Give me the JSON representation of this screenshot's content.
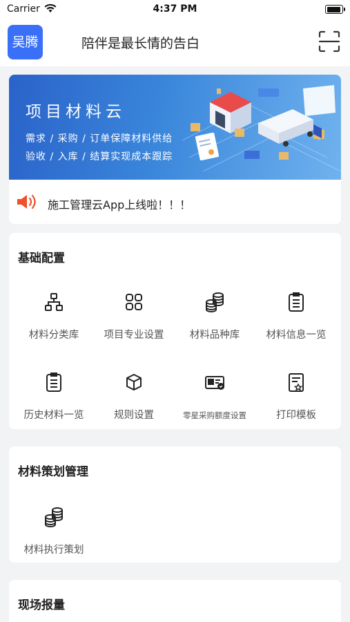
{
  "status_bar": {
    "carrier": "Carrier",
    "time": "4:37 PM"
  },
  "header": {
    "avatar_text": "吴腾",
    "title": "陪伴是最长情的告白",
    "scan_icon": "scan-icon"
  },
  "banner": {
    "title": "项目材料云",
    "line1": "需求 / 采购 / 订单保障材料供给",
    "line2": "验收 / 入库 / 结算实现成本跟踪"
  },
  "notice": {
    "text": "施工管理云App上线啦！！！",
    "icon": "speaker-icon",
    "icon_color": "#f0502a"
  },
  "sections": {
    "basic": {
      "title": "基础配置",
      "items": [
        {
          "label": "材料分类库",
          "icon": "hierarchy-icon"
        },
        {
          "label": "项目专业设置",
          "icon": "grid-icon"
        },
        {
          "label": "材料品种库",
          "icon": "coins-stack-icon"
        },
        {
          "label": "材料信息一览",
          "icon": "clipboard-list-icon"
        },
        {
          "label": "历史材料一览",
          "icon": "clipboard-list-icon"
        },
        {
          "label": "规则设置",
          "icon": "cube-icon"
        },
        {
          "label": "零星采购额度设置",
          "icon": "card-check-icon"
        },
        {
          "label": "打印模板",
          "icon": "template-icon"
        }
      ]
    },
    "planning": {
      "title": "材料策划管理",
      "items": [
        {
          "label": "材料执行策划",
          "icon": "coins-stack-icon"
        }
      ]
    },
    "site": {
      "title": "现场报量"
    }
  },
  "colors": {
    "accent": "#3a6ff7",
    "background": "#f2f3f5"
  }
}
